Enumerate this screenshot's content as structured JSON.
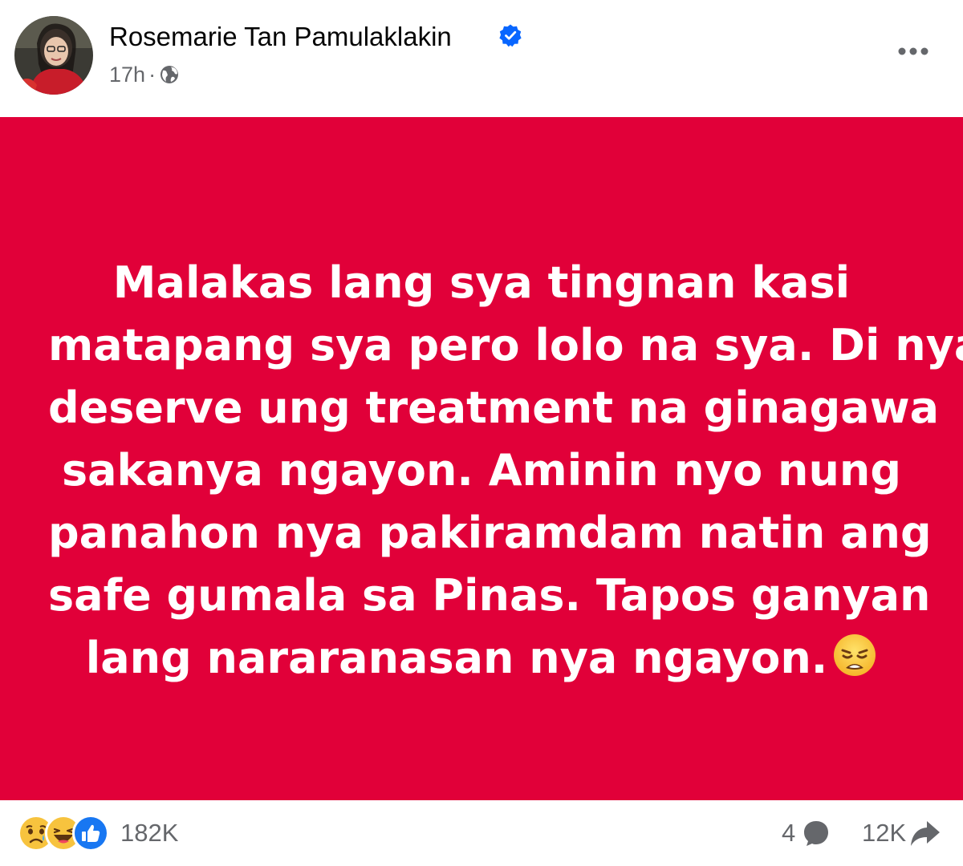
{
  "author": {
    "name": "Rosemarie Tan Pamulaklakin",
    "verified": true,
    "avatar_icon": "profile-photo"
  },
  "meta": {
    "time": "17h",
    "separator": "·",
    "audience_icon": "globe-icon"
  },
  "post": {
    "background_color": "#e10039",
    "text_color": "#ffffff",
    "lines": [
      "Malakas lang sya tingnan kasi",
      "matapang sya pero lolo na sya. Di nya",
      "deserve ung treatment na ginagawa",
      "sakanya ngayon. Aminin nyo nung",
      "panahon nya pakiramdam natin ang",
      "safe gumala sa Pinas. Tapos ganyan",
      "lang nararanasan nya ngayon."
    ],
    "trailing_emoji": "tired-face-emoji"
  },
  "footer": {
    "reaction_icons": [
      "sad-reaction-icon",
      "haha-reaction-icon",
      "like-reaction-icon"
    ],
    "reaction_count": "182K",
    "comment_count": "4",
    "share_count": "12K"
  },
  "colors": {
    "accent": "#0866ff",
    "muted_text": "#65676b"
  }
}
